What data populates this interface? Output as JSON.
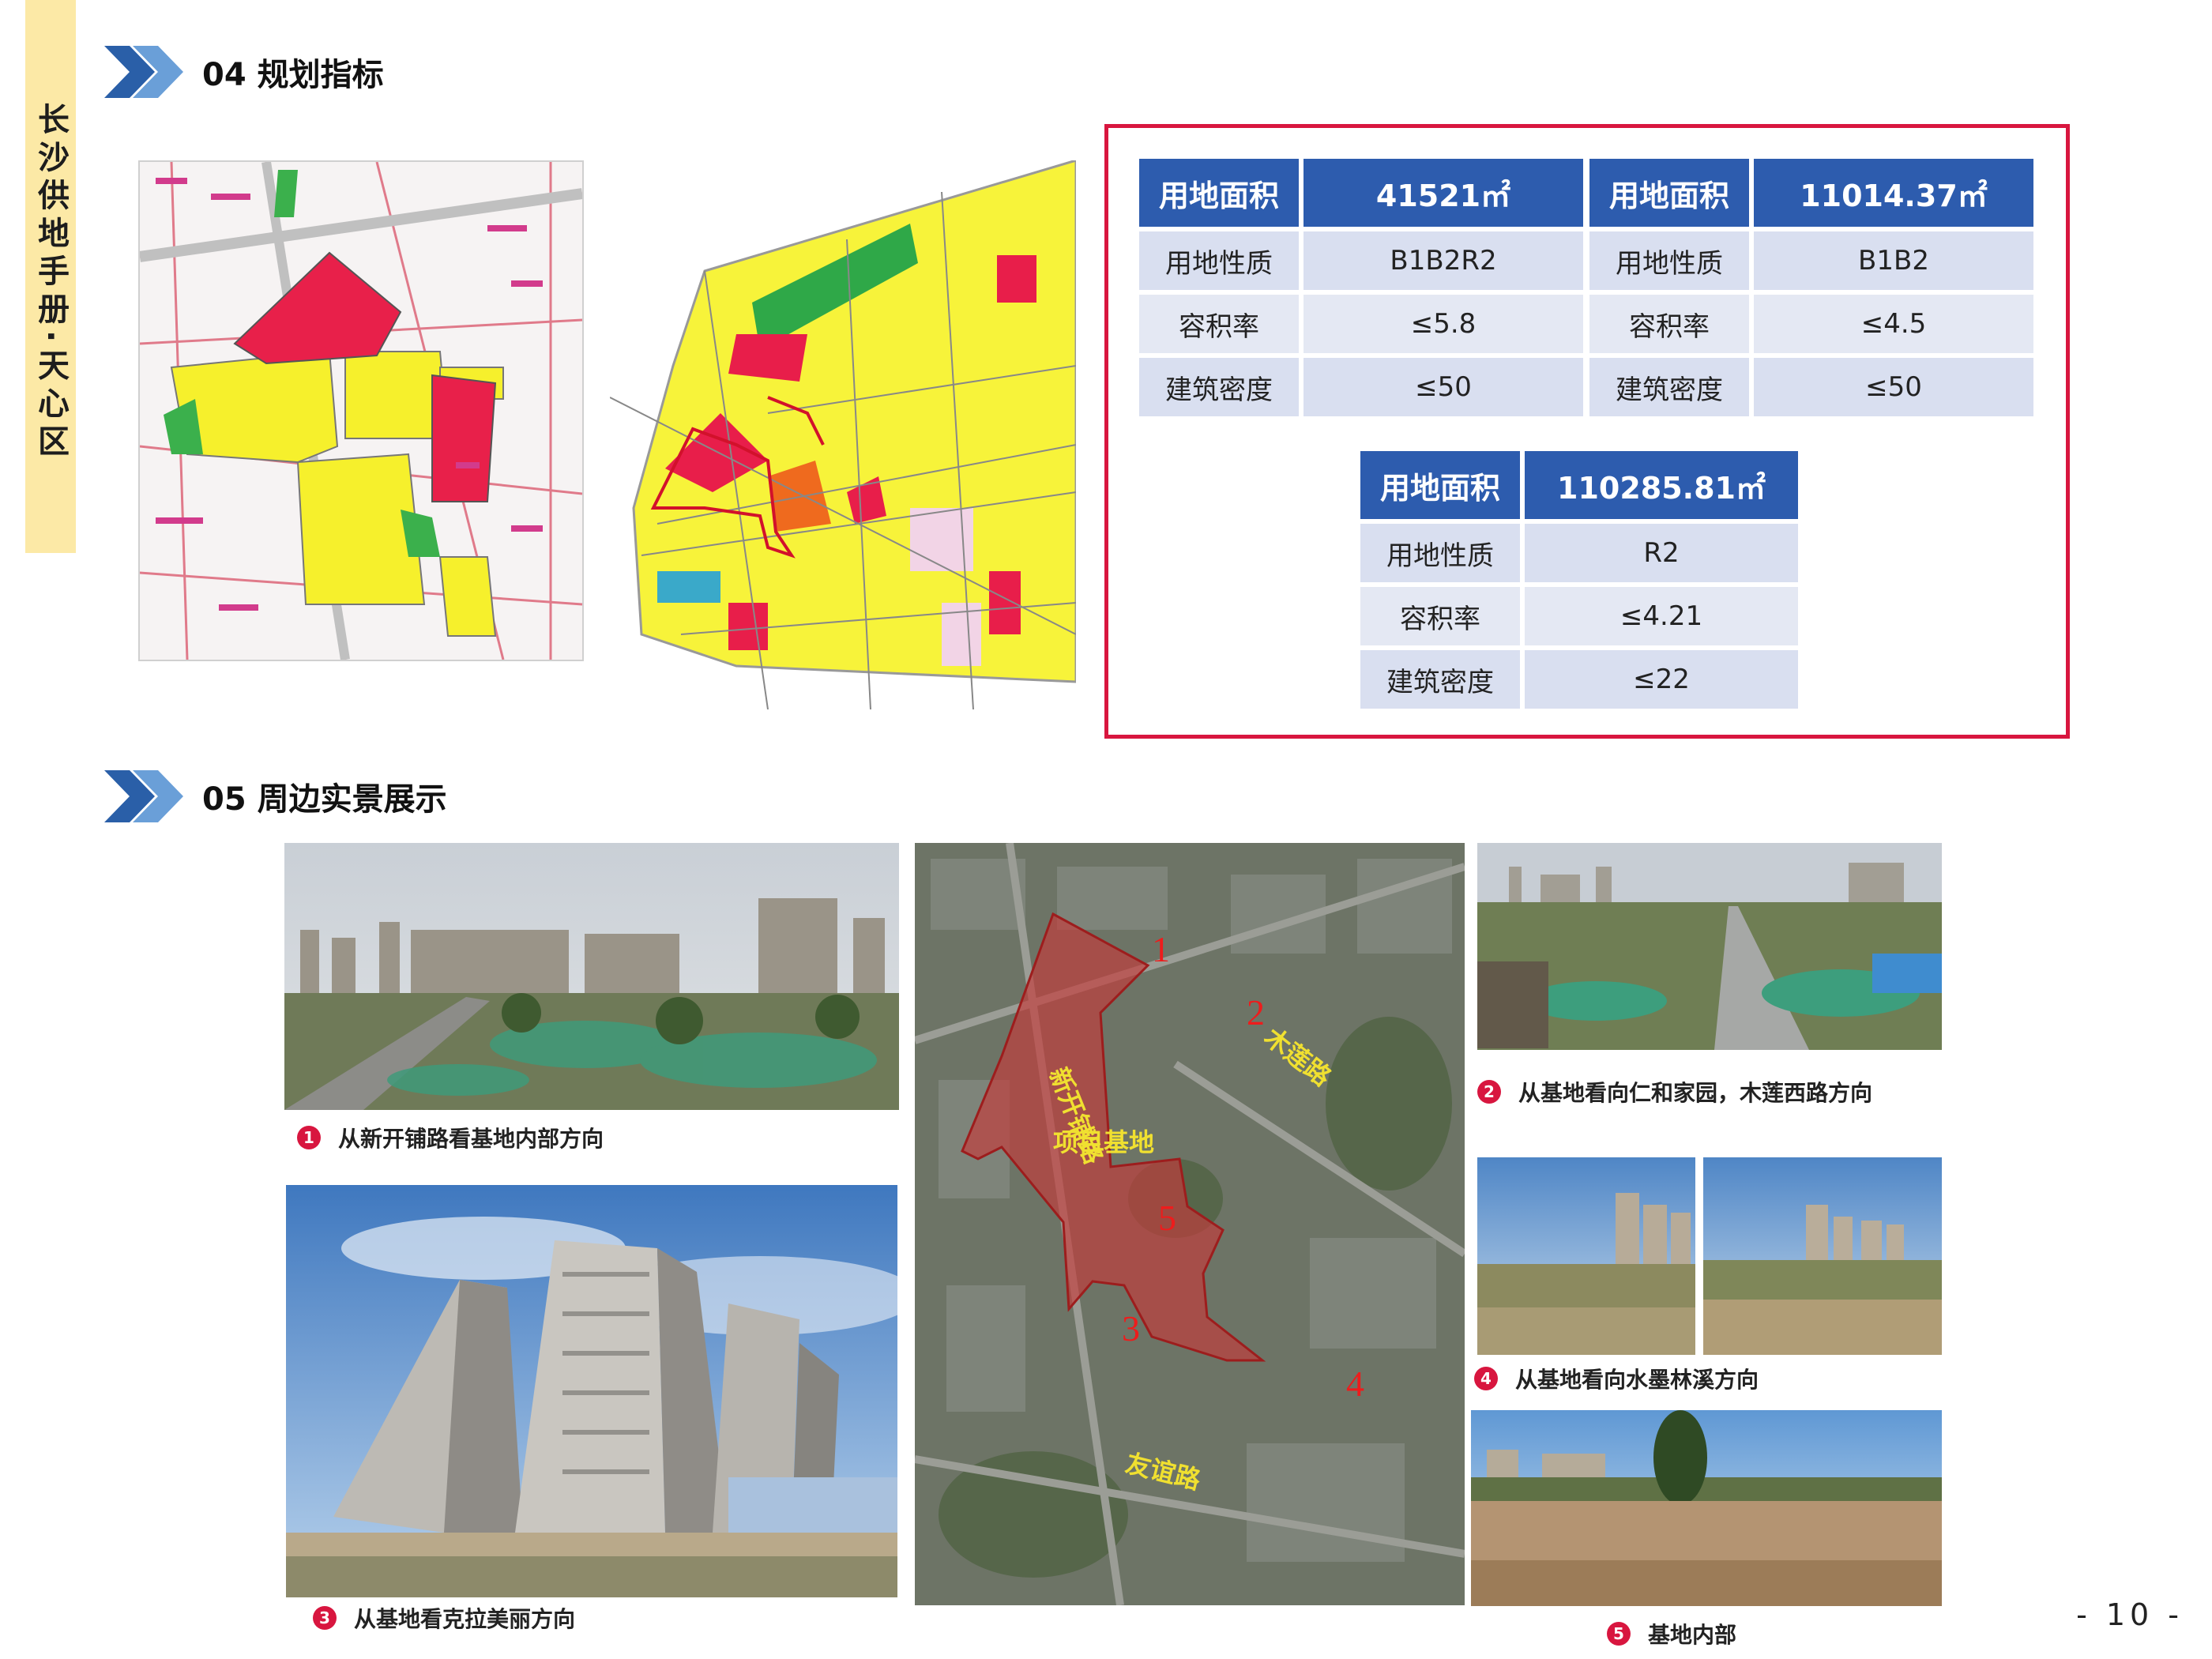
{
  "side_banner": "长沙供地手册·天心区",
  "section_04": "04 规划指标",
  "section_05": "05 周边实景展示",
  "table_a": {
    "headers": [
      "用地面积",
      "41521㎡"
    ],
    "rows": [
      [
        "用地性质",
        "B1B2R2"
      ],
      [
        "容积率",
        "≤5.8"
      ],
      [
        "建筑密度",
        "≤50"
      ]
    ]
  },
  "table_b": {
    "headers": [
      "用地面积",
      "11014.37㎡"
    ],
    "rows": [
      [
        "用地性质",
        "B1B2"
      ],
      [
        "容积率",
        "≤4.5"
      ],
      [
        "建筑密度",
        "≤50"
      ]
    ]
  },
  "table_c": {
    "headers": [
      "用地面积",
      "110285.81㎡"
    ],
    "rows": [
      [
        "用地性质",
        "R2"
      ],
      [
        "容积率",
        "≤4.21"
      ],
      [
        "建筑密度",
        "≤22"
      ]
    ]
  },
  "aerial": {
    "markers": [
      "1",
      "2",
      "3",
      "4",
      "5"
    ],
    "roads": [
      "新开铺路",
      "木莲路",
      "友谊路"
    ],
    "site_label": "项目基地"
  },
  "captions": {
    "c1": {
      "num": "1",
      "text": "从新开铺路看基地内部方向"
    },
    "c2": {
      "num": "2",
      "text": "从基地看向仁和家园，木莲西路方向"
    },
    "c3": {
      "num": "3",
      "text": "从基地看克拉美丽方向"
    },
    "c4": {
      "num": "4",
      "text": "从基地看向水墨林溪方向"
    },
    "c5": {
      "num": "5",
      "text": "基地内部"
    }
  },
  "page_number": "- 10 -",
  "colors": {
    "accent_red": "#d8163f",
    "table_header": "#2d5cae",
    "table_cell": "#d9dff0",
    "banner": "#fce9a6"
  }
}
